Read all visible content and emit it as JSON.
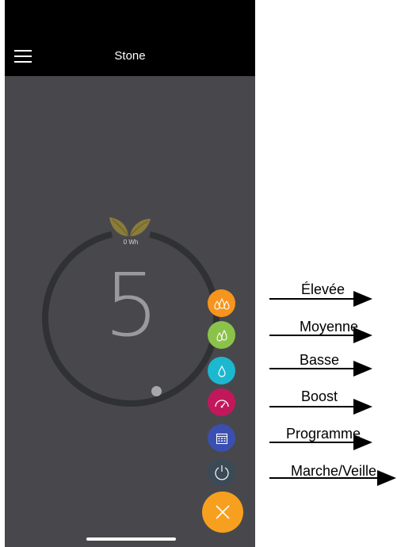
{
  "header": {
    "title": "Stone"
  },
  "dial": {
    "setpoint": "5",
    "energy": "0 Wh"
  },
  "modes": [
    {
      "id": "elevee",
      "label": "Élevée",
      "color": "#f7941d",
      "icon": "triple-drop-icon"
    },
    {
      "id": "moyenne",
      "label": "Moyenne",
      "color": "#8bc34a",
      "icon": "double-drop-icon"
    },
    {
      "id": "basse",
      "label": "Basse",
      "color": "#1cb8d0",
      "icon": "drop-icon"
    },
    {
      "id": "boost",
      "label": "Boost",
      "color": "#c2185b",
      "icon": "gauge-icon"
    },
    {
      "id": "programme",
      "label": "Programme",
      "color": "#3a4fb0",
      "icon": "calendar-icon"
    },
    {
      "id": "veille",
      "label": "Marche/Veille",
      "color": "#3a4a56",
      "icon": "power-icon"
    }
  ],
  "fab": {
    "color": "#f7a020",
    "icon": "close-icon"
  },
  "annotations": {
    "elevee": "Élevée",
    "moyenne": "Moyenne",
    "basse": "Basse",
    "boost": "Boost",
    "programme": "Programme",
    "veille": "Marche/Veille"
  }
}
